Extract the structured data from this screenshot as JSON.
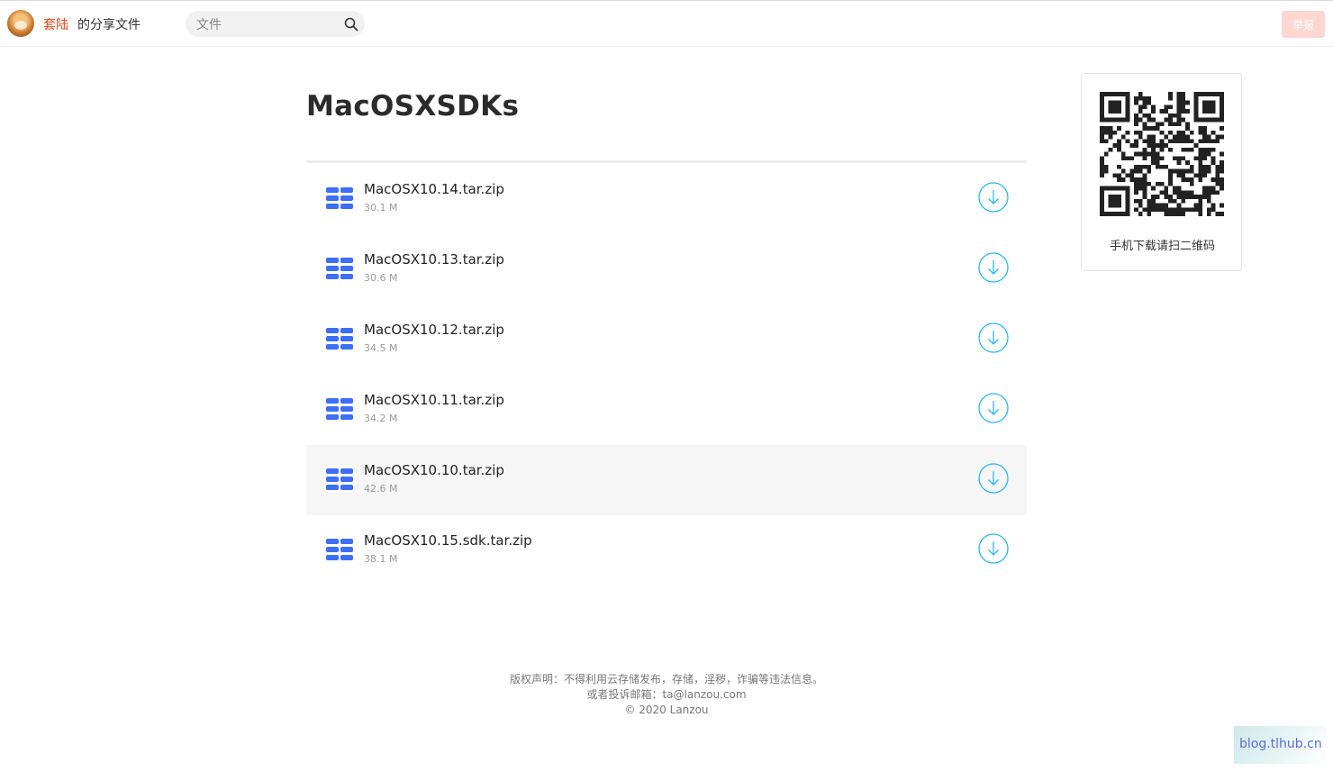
{
  "header": {
    "owner_name": "套陆",
    "share_label": "的分享文件",
    "search_placeholder": "文件",
    "report_label": "举报"
  },
  "folder": {
    "title": "MacOSXSDKs"
  },
  "files": [
    {
      "name": "MacOSX10.14.tar.zip",
      "size": "30.1 M"
    },
    {
      "name": "MacOSX10.13.tar.zip",
      "size": "30.6 M"
    },
    {
      "name": "MacOSX10.12.tar.zip",
      "size": "34.5 M"
    },
    {
      "name": "MacOSX10.11.tar.zip",
      "size": "34.2 M"
    },
    {
      "name": "MacOSX10.10.tar.zip",
      "size": "42.6 M"
    },
    {
      "name": "MacOSX10.15.sdk.tar.zip",
      "size": "38.1 M"
    }
  ],
  "qr": {
    "caption": "手机下载请扫二维码"
  },
  "footer": {
    "line1": "版权声明：不得利用云存储发布，存储，淫秽，诈骗等违法信息。",
    "line2": "或者投诉邮箱：ta@lanzou.com",
    "line3": "© 2020 Lanzou"
  },
  "watermark": "blog.tlhub.cn",
  "colors": {
    "accent_owner": "#e64a19",
    "download_icon": "#29b6f6",
    "file_icon": "#3d6ef5",
    "report_button": "#ffd7d2"
  },
  "icons": [
    "search-icon",
    "file-icon",
    "download-icon",
    "qr-code"
  ]
}
